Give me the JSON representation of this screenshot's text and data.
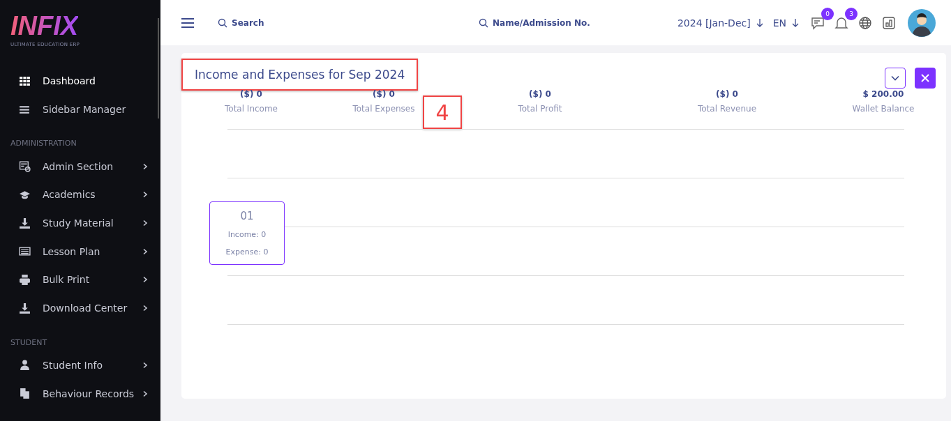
{
  "sidebar": {
    "logo": "INFIX",
    "tagline": "ULTIMATE EDUCATION ERP",
    "sections": [
      {
        "items": [
          {
            "label": "Dashboard",
            "selected": true,
            "has_submenu": false
          },
          {
            "label": "Sidebar Manager",
            "selected": false,
            "has_submenu": false
          }
        ]
      },
      {
        "heading": "ADMINISTRATION",
        "items": [
          {
            "label": "Admin Section",
            "selected": false,
            "has_submenu": true
          },
          {
            "label": "Academics",
            "selected": false,
            "has_submenu": true
          },
          {
            "label": "Study Material",
            "selected": false,
            "has_submenu": true
          },
          {
            "label": "Lesson Plan",
            "selected": false,
            "has_submenu": true
          },
          {
            "label": "Bulk Print",
            "selected": false,
            "has_submenu": true
          },
          {
            "label": "Download Center",
            "selected": false,
            "has_submenu": true
          }
        ]
      },
      {
        "heading": "STUDENT",
        "items": [
          {
            "label": "Student Info",
            "selected": false,
            "has_submenu": true
          },
          {
            "label": "Behaviour Records",
            "selected": false,
            "has_submenu": true
          }
        ]
      }
    ]
  },
  "topbar": {
    "search": {
      "placeholder": "Search"
    },
    "student_search": {
      "placeholder": "Name/Admission No."
    },
    "session": "2024 [Jan-Dec]",
    "language": "EN",
    "messages_badge": "0",
    "notifications_badge": "3"
  },
  "card": {
    "title": "Income and Expenses for Sep 2024",
    "title_highlighted": true,
    "annotation": "4",
    "stats": [
      {
        "value": "($) 0",
        "label": "Total Income"
      },
      {
        "value": "($) 0",
        "label": "Total Expenses"
      },
      {
        "value": "($) 0",
        "label": "Total Profit"
      },
      {
        "value": "($) 0",
        "label": "Total Revenue"
      },
      {
        "value": "$ 200.00",
        "label": "Wallet Balance"
      }
    ],
    "tooltip": {
      "title": "01",
      "lines": [
        "Income: 0",
        "Expense: 0"
      ]
    }
  }
}
